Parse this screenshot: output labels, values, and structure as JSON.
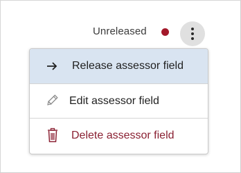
{
  "status": {
    "label": "Unreleased",
    "dot_color": "#a3182a"
  },
  "more_button": {
    "icon": "vertical-ellipsis-icon"
  },
  "menu": {
    "items": [
      {
        "label": "Release assessor field",
        "icon": "arrow-right-icon",
        "highlighted": true
      },
      {
        "label": "Edit assessor field",
        "icon": "pencil-icon",
        "highlighted": false
      },
      {
        "label": "Delete assessor field",
        "icon": "trash-icon",
        "highlighted": false,
        "color": "#8a2032"
      }
    ],
    "highlight_color": "#d9e4f1"
  }
}
